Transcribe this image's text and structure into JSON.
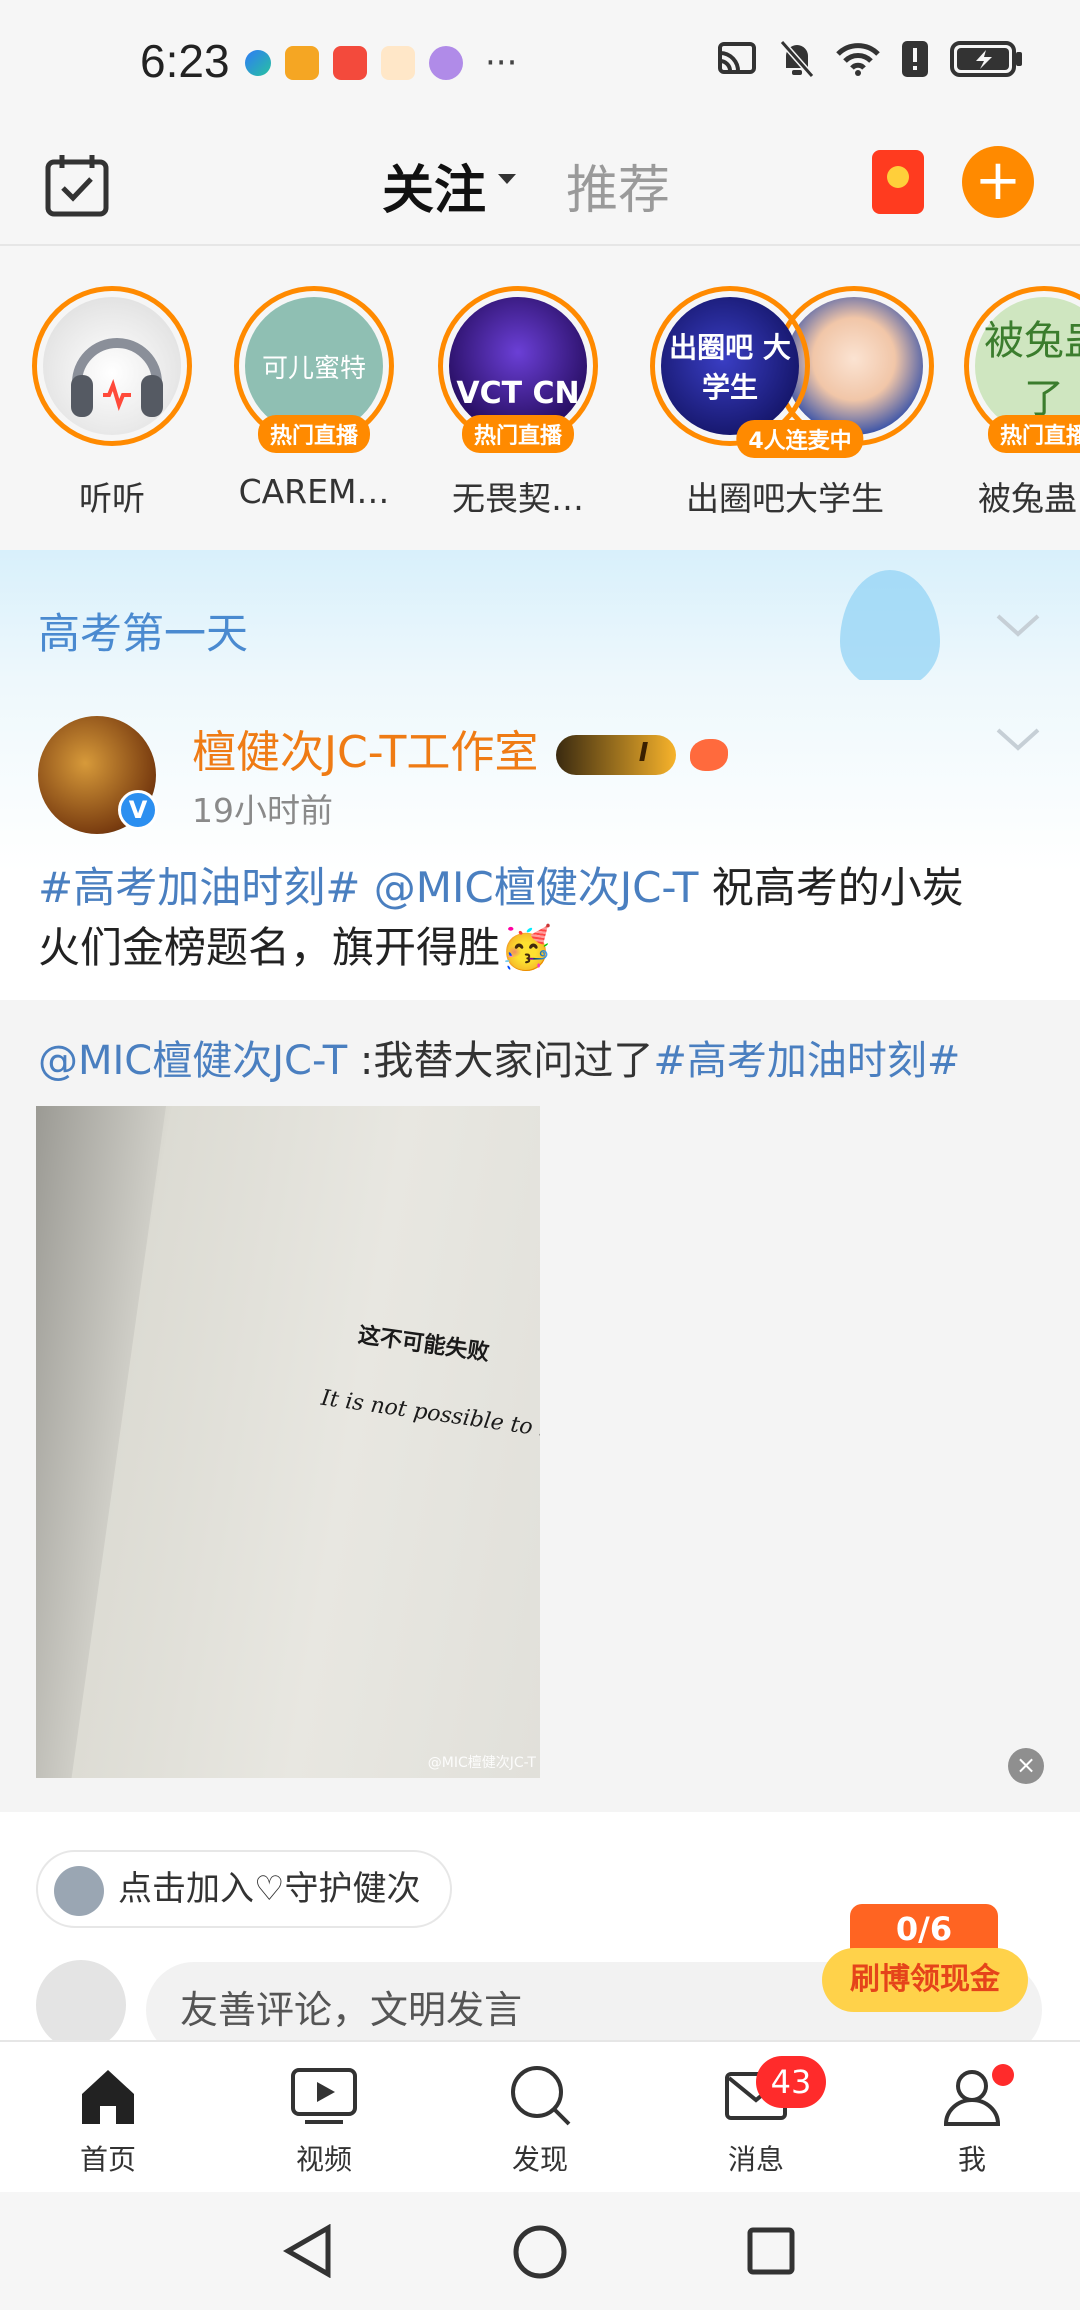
{
  "status_bar": {
    "time": "6:23",
    "more": "···"
  },
  "top_nav": {
    "tab_follow": "关注",
    "tab_recommend": "推荐"
  },
  "live_stories": [
    {
      "name": "听听",
      "badge": ""
    },
    {
      "name": "CAREM…",
      "badge": "热门直播",
      "avatar_text": "可儿蜜特"
    },
    {
      "name": "无畏契…",
      "badge": "热门直播",
      "avatar_text": "VCT CN"
    },
    {
      "name": "出圈吧大学生",
      "badge": "4人连麦中",
      "avatar_text": "出圈吧 大学生"
    },
    {
      "name": "被兔蛊了",
      "badge": "热门直播",
      "avatar_text": "被兔蛊了"
    }
  ],
  "topic": {
    "title": "高考第一天"
  },
  "post": {
    "author": "檀健次JC-T工作室",
    "vip_level": "I",
    "time": "19小时前",
    "hashtag": "#高考加油时刻#",
    "mention": "@MIC檀健次JC-T",
    "body_line1": " 祝高考的小炭",
    "body_line2": "火们金榜题名，旗开得胜🥳"
  },
  "repost": {
    "mention": "@MIC檀健次JC-T",
    "text": " :我替大家问过了",
    "hashtag": "#高考加油时刻#",
    "image": {
      "cn": "这不可能失败",
      "en": "It is not possible to lose",
      "watermark": "@MIC檀健次JC-T"
    }
  },
  "guard_button": "点击加入♡守护健次",
  "comment_placeholder": "友善评论，文明发言",
  "reward": {
    "progress": "0/6",
    "label": "刷博领现金"
  },
  "bottom_nav": [
    {
      "label": "首页",
      "icon": "home-icon"
    },
    {
      "label": "视频",
      "icon": "video-icon"
    },
    {
      "label": "发现",
      "icon": "search-icon"
    },
    {
      "label": "消息",
      "icon": "mail-icon",
      "badge": "43"
    },
    {
      "label": "我",
      "icon": "profile-icon"
    }
  ],
  "colors": {
    "accent": "#ff8a00",
    "link": "#4a7fc0",
    "author": "#ef7b14",
    "badge_red": "#ff2b2b"
  }
}
